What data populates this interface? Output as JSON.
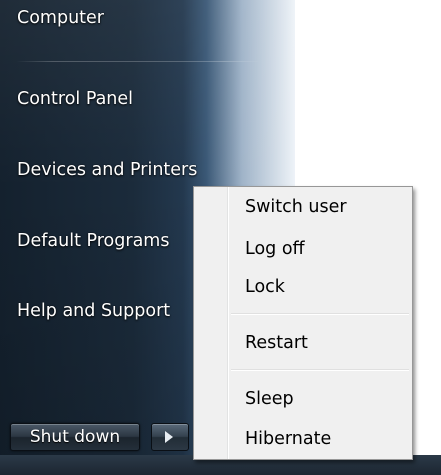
{
  "start_menu": {
    "items": [
      {
        "label": "Computer"
      },
      {
        "label": "Control Panel"
      },
      {
        "label": "Devices and Printers"
      },
      {
        "label": "Default Programs"
      },
      {
        "label": "Help and Support"
      }
    ],
    "shutdown_label": "Shut down"
  },
  "shutdown_menu": {
    "items": [
      {
        "label": "Switch user"
      },
      {
        "label": "Log off"
      },
      {
        "label": "Lock"
      },
      {
        "label": "Restart"
      },
      {
        "label": "Sleep"
      },
      {
        "label": "Hibernate"
      }
    ]
  }
}
